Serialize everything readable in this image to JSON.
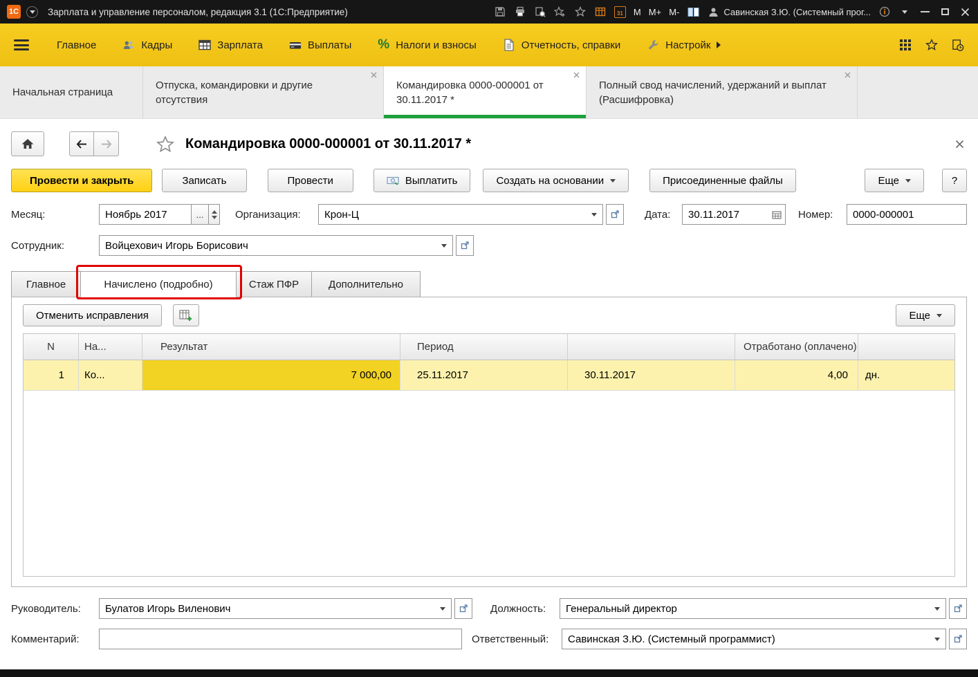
{
  "titlebar": {
    "logo_text": "1С",
    "app_title": "Зарплата и управление персоналом, редакция 3.1  (1С:Предприятие)",
    "memory_m": "M",
    "memory_m_plus": "M+",
    "memory_m_minus": "M-",
    "calendar_day": "31",
    "user_name": "Савинская З.Ю. (Системный прог..."
  },
  "menubar": {
    "percent_symbol": "%",
    "items": [
      {
        "label": "Главное"
      },
      {
        "label": "Кадры"
      },
      {
        "label": "Зарплата"
      },
      {
        "label": "Выплаты"
      },
      {
        "label": "Налоги и взносы"
      },
      {
        "label": "Отчетность, справки"
      },
      {
        "label": "Настройк"
      }
    ]
  },
  "main_tabs": [
    {
      "label": "Начальная страница"
    },
    {
      "label": "Отпуска, командировки и другие отсутствия"
    },
    {
      "label": "Командировка 0000-000001 от 30.11.2017 *"
    },
    {
      "label": "Полный свод начислений, удержаний и выплат (Расшифровка)"
    }
  ],
  "document": {
    "title": "Командировка 0000-000001 от 30.11.2017 *",
    "toolbar": {
      "post_and_close": "Провести и закрыть",
      "write": "Записать",
      "post": "Провести",
      "pay": "Выплатить",
      "create_on_basis": "Создать на основании",
      "attached_files": "Присоединенные файлы",
      "more": "Еще",
      "help": "?"
    },
    "fields": {
      "month": {
        "label": "Месяц:",
        "value": "Ноябрь 2017",
        "ellipsis": "..."
      },
      "organization": {
        "label": "Организация:",
        "value": "Крон-Ц"
      },
      "date": {
        "label": "Дата:",
        "value": "30.11.2017"
      },
      "number": {
        "label": "Номер:",
        "value": "0000-000001"
      },
      "employee": {
        "label": "Сотрудник:",
        "value": "Войцехович Игорь Борисович"
      }
    },
    "form_tabs": [
      {
        "label": "Главное"
      },
      {
        "label": "Начислено (подробно)"
      },
      {
        "label": "Стаж ПФР"
      },
      {
        "label": "Дополнительно"
      }
    ],
    "grid_toolbar": {
      "undo_corrections": "Отменить исправления",
      "more": "Еще"
    },
    "table": {
      "headers": [
        "N",
        "На...",
        "Результат",
        "Период",
        "",
        "Отработано (оплачено)",
        ""
      ],
      "rows": [
        [
          "1",
          "Ко...",
          "7 000,00",
          "25.11.2017",
          "30.11.2017",
          "4,00",
          "дн."
        ]
      ]
    },
    "footer": {
      "manager": {
        "label": "Руководитель:",
        "value": "Булатов Игорь Виленович"
      },
      "position": {
        "label": "Должность:",
        "value": "Генеральный директор"
      },
      "comment": {
        "label": "Комментарий:",
        "value": ""
      },
      "responsible": {
        "label": "Ответственный:",
        "value": "Савинская З.Ю. (Системный программист)"
      }
    }
  }
}
